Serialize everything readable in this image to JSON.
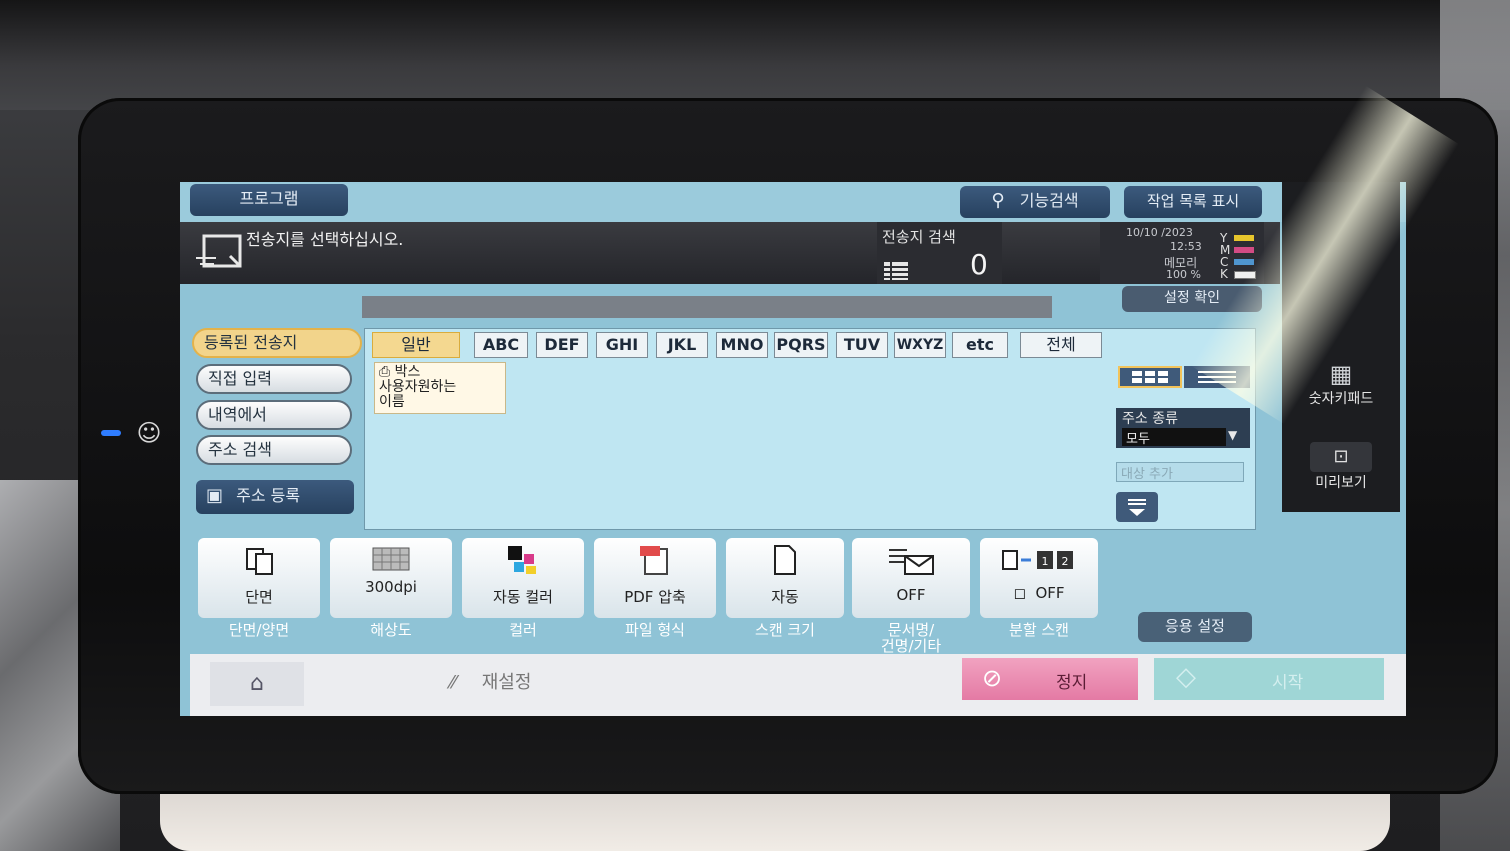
{
  "header": {
    "program_tab": "프로그램",
    "function_search": "기능검색",
    "job_list": "작업 목록 표시"
  },
  "message": "전송지를 선택하십시오.",
  "destination_search": {
    "label": "전송지 검색",
    "count": "0"
  },
  "status": {
    "date": "10/10 /2023",
    "time": "12:53",
    "memory_label": "메모리",
    "memory_value": "100 %",
    "toner": [
      "Y",
      "M",
      "C",
      "K"
    ],
    "toner_colors": [
      "#e7c52c",
      "#d24b84",
      "#4f95cf",
      "#f0f0f0"
    ]
  },
  "settings_check": "설정 확인",
  "left_menu": [
    {
      "label": "등록된 전송지",
      "active": true
    },
    {
      "label": "직접 입력",
      "active": false
    },
    {
      "label": "내역에서",
      "active": false
    },
    {
      "label": "주소 검색",
      "active": false
    }
  ],
  "address_register": "주소 등록",
  "index_tabs": [
    "일반",
    "ABC",
    "DEF",
    "GHI",
    "JKL",
    "MNO",
    "PQRS",
    "TUV",
    "WXYZ",
    "etc",
    "전체"
  ],
  "box_item": {
    "type": "박스",
    "line1": "사용자원하는",
    "line2": "이름"
  },
  "address_type": {
    "label": "주소 종류",
    "value": "모두"
  },
  "add_target_placeholder": "대상 추가",
  "functions": [
    {
      "value": "단면",
      "label": "단면/양면",
      "label2": ""
    },
    {
      "value": "300dpi",
      "label": "해상도",
      "label2": ""
    },
    {
      "value": "자동 컬러",
      "label": "컬러",
      "label2": ""
    },
    {
      "value": "PDF 압축",
      "label": "파일 형식",
      "label2": ""
    },
    {
      "value": "자동",
      "label": "스캔 크기",
      "label2": ""
    },
    {
      "value": "OFF",
      "label": "문서명/",
      "label2": "건명/기타"
    },
    {
      "value": "OFF",
      "label": "분할 스캔",
      "label2": ""
    }
  ],
  "application_settings": "응용 설정",
  "bottom": {
    "reset": "재설정",
    "stop": "정지",
    "start": "시작"
  },
  "side_panel": {
    "keypad": "숫자키패드",
    "preview": "미리보기"
  }
}
